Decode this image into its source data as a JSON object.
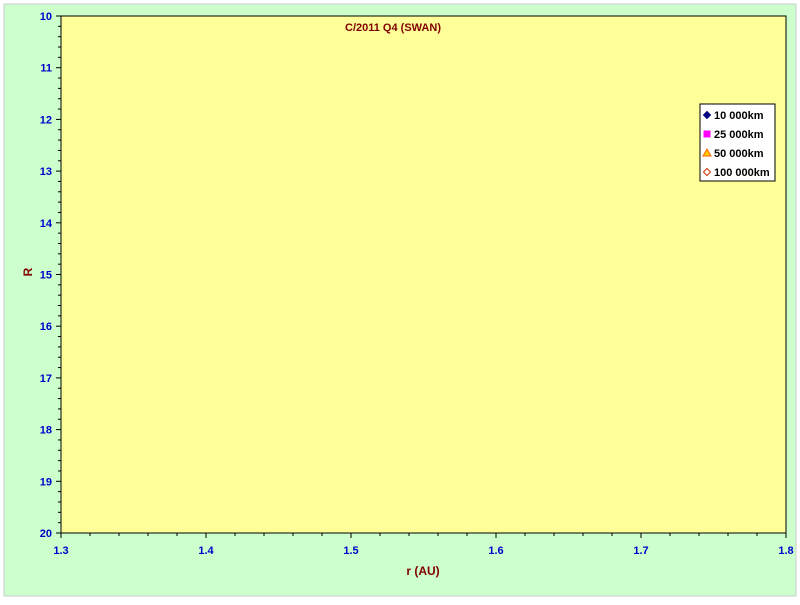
{
  "chart_data": {
    "type": "scatter",
    "title": "C/2011 Q4 (SWAN)",
    "xlabel": "r (AU)",
    "ylabel": "R",
    "xlim": [
      1.3,
      1.8
    ],
    "ylim": [
      10,
      20
    ],
    "y_inverted": true,
    "x_ticks": [
      "1.3",
      "1.4",
      "1.5",
      "1.6",
      "1.7",
      "1.8"
    ],
    "y_ticks": [
      "10",
      "11",
      "12",
      "13",
      "14",
      "15",
      "16",
      "17",
      "18",
      "19",
      "20"
    ],
    "grid": false,
    "legend_position": "right",
    "series": [
      {
        "name": "10 000km",
        "marker": "diamond",
        "color": "#000080",
        "points": []
      },
      {
        "name": "25 000km",
        "marker": "square",
        "color": "#ff00ff",
        "points": []
      },
      {
        "name": "50 000km",
        "marker": "triangle",
        "color": "#ff6600",
        "points": []
      },
      {
        "name": "100 000km",
        "marker": "open-diamond",
        "color": "#cc3300",
        "points": []
      }
    ]
  },
  "colors": {
    "outer_background": "#ccffcc",
    "plot_background": "#ffff99",
    "tick_label": "#0000cc",
    "title_text": "#800000",
    "axis_label": "#800000"
  }
}
